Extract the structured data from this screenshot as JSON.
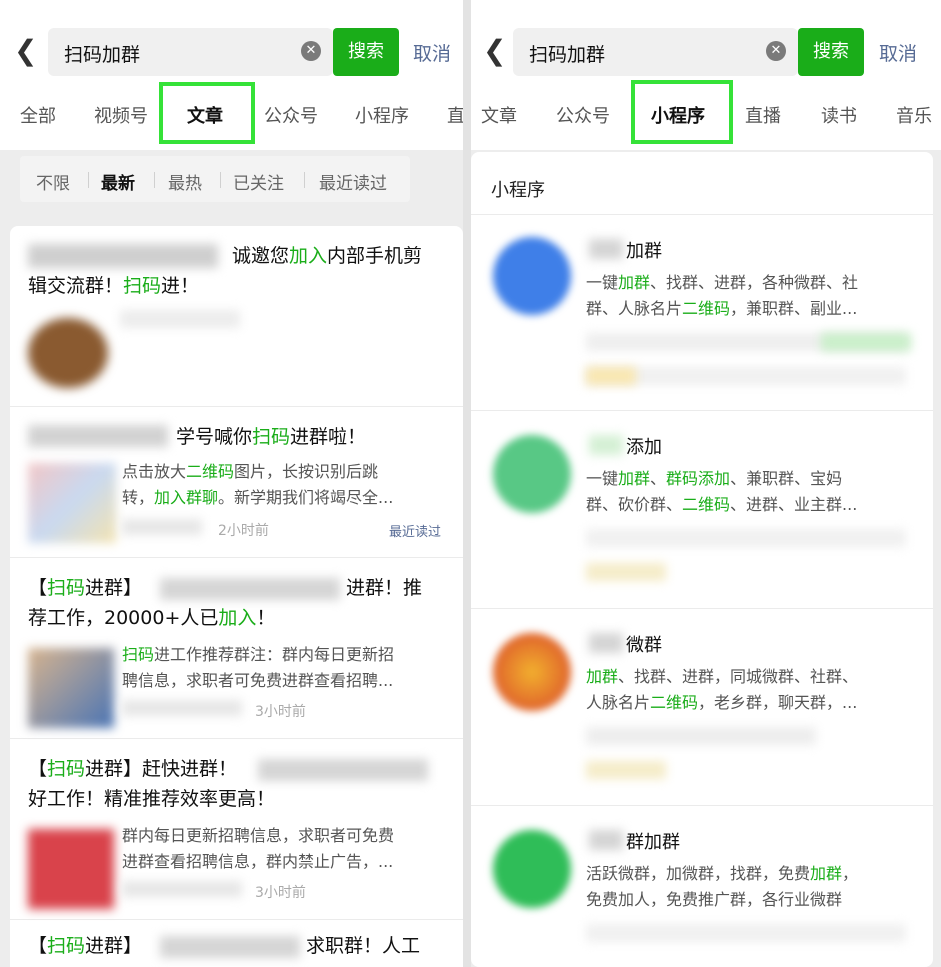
{
  "left": {
    "query": "扫码加群",
    "search_btn": "搜索",
    "cancel": "取消",
    "tabs": [
      "全部",
      "视频号",
      "文章",
      "公众号",
      "小程序",
      "直"
    ],
    "filters": [
      "不限",
      "最新",
      "最热",
      "已关注",
      "最近读过"
    ],
    "articles": [
      {
        "t1": "诚邀您",
        "t2": "加入",
        "t3": "内部手机剪",
        "t4": "辑交流群！",
        "t5": "扫码",
        "t6": "进！"
      },
      {
        "t1": "学号喊你",
        "t2": "扫码",
        "t3": "进群啦！",
        "s1": "点击放大",
        "s2": "二维码",
        "s3": "图片，长按识别后跳",
        "s4": "转，",
        "s5": "加入群聊",
        "s6": "。新学期我们将竭尽全...",
        "time": "2小时前",
        "tag": "最近读过"
      },
      {
        "t1": "【",
        "t2": "扫码",
        "t3": "进群】",
        "t4": "进群！推",
        "t5": "荐工作，20000+人已",
        "t6": "加入",
        "t7": "！",
        "s1": "扫码",
        "s2": "进工作推荐群注：群内每日更新招",
        "s3": "聘信息，求职者可免费进群查看招聘...",
        "time": "3小时前"
      },
      {
        "t1": "【",
        "t2": "扫码",
        "t3": "进群】赶快进群！",
        "t4": "好工作！精准推荐效率更高！",
        "s1": "群内每日更新招聘信息，求职者可免费",
        "s2": "进群查看招聘信息，群内禁止广告，...",
        "time": "3小时前"
      },
      {
        "t1": "【",
        "t2": "扫码",
        "t3": "进群】",
        "t4": "求职群！人工"
      }
    ]
  },
  "right": {
    "query": "扫码加群",
    "search_btn": "搜索",
    "cancel": "取消",
    "tabs": [
      "文章",
      "公众号",
      "小程序",
      "直播",
      "读书",
      "音乐"
    ],
    "section_title": "小程序",
    "apps": [
      {
        "name": "加群",
        "d1a": "一键",
        "d1b": "加群",
        "d1c": "、找群、进群，各种微群、社",
        "d2a": "群、人脉名片",
        "d2b": "二维码",
        "d2c": "，兼职群、副业..."
      },
      {
        "name": "添加",
        "d1a": "一键",
        "d1b": "加群",
        "d1c": "、",
        "d1d": "群码添加",
        "d1e": "、兼职群、宝妈",
        "d2a": "群、砍价群、",
        "d2b": "二维码",
        "d2c": "、进群、业主群..."
      },
      {
        "name": "微群",
        "d1a": "加群",
        "d1b": "、找群、进群，同城微群、社群、",
        "d2a": "人脉名片",
        "d2b": "二维码",
        "d2c": "，老乡群，聊天群，..."
      },
      {
        "name": "群加群",
        "d1a": "活跃微群，加微群，找群，免费",
        "d1b": "加群",
        "d1c": "，",
        "d2a": "免费加人，免费推广群，各行业微群"
      }
    ]
  }
}
